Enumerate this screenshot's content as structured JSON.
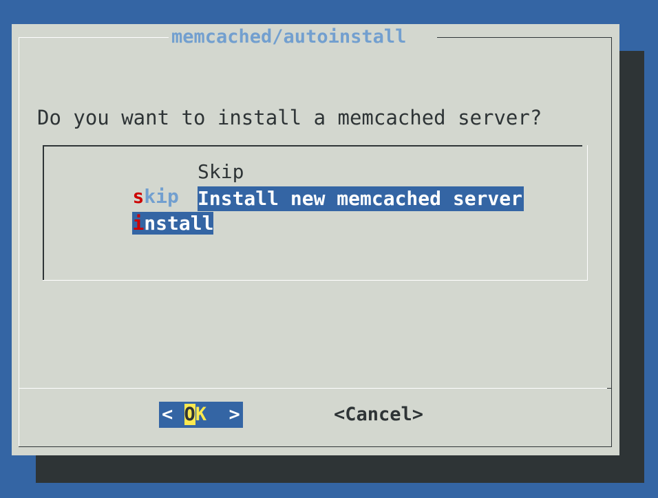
{
  "dialog": {
    "title": "memcached/autoinstall",
    "prompt": "Do you want to install a memcached server?"
  },
  "menu": {
    "items": [
      {
        "tag_hotkey": "s",
        "tag_rest": "kip",
        "description": "Skip",
        "selected": false
      },
      {
        "tag_hotkey": "i",
        "tag_rest": "nstall",
        "description": "Install new memcached server",
        "selected": true
      }
    ]
  },
  "buttons": {
    "ok_left": "< ",
    "ok_hotkey": "O",
    "ok_rest": "K",
    "ok_right": "  >",
    "cancel": "<Cancel>"
  },
  "colors": {
    "desktop": "#3465a4",
    "dialog": "#d3d7cf",
    "shadow": "#2e3436",
    "highlight": "#3465a4",
    "hotkey": "#cc0000",
    "title": "#729fcf",
    "button_hotkey": "#fce94f"
  }
}
